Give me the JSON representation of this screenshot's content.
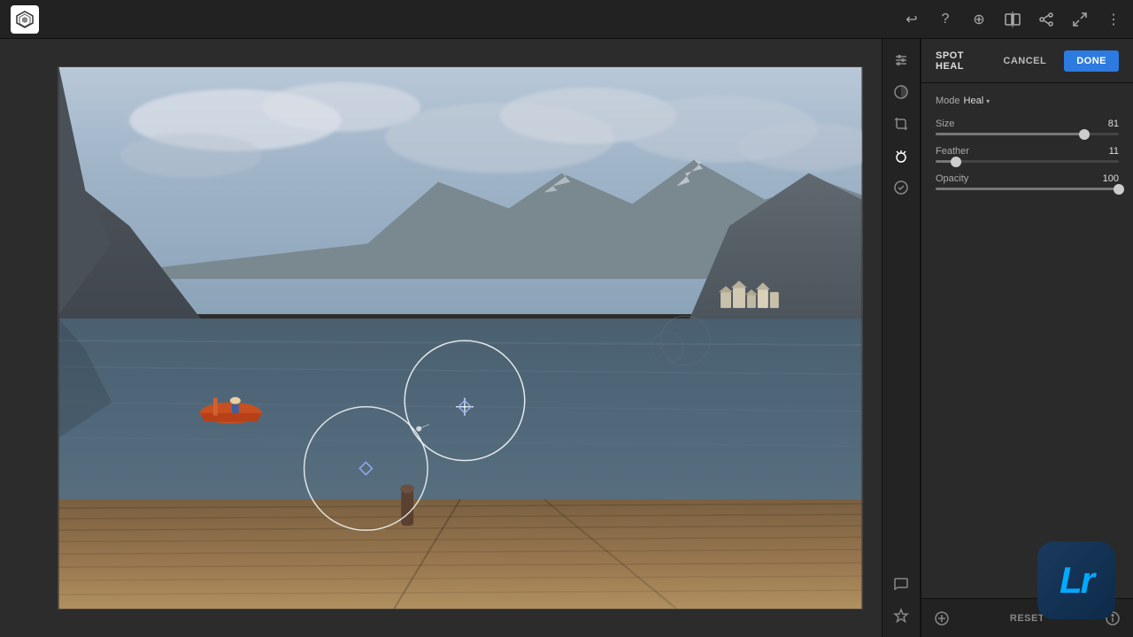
{
  "topbar": {
    "undo_title": "Undo",
    "help_title": "Help",
    "add_title": "Add",
    "compare_title": "Compare",
    "share_title": "Share",
    "expand_title": "Expand",
    "more_title": "More options"
  },
  "spot_heal": {
    "title": "SPOT HEAL",
    "cancel_label": "CANCEL",
    "done_label": "DONE"
  },
  "controls": {
    "mode_label": "Mode",
    "mode_value": "Heal",
    "size_label": "Size",
    "size_value": "81",
    "size_percent": 81,
    "feather_label": "Feather",
    "feather_value": "11",
    "feather_percent": 11,
    "opacity_label": "Opacity",
    "opacity_value": "100",
    "opacity_percent": 100
  },
  "bottom_bar": {
    "reset_label": "RESET"
  },
  "lr_badge": {
    "text": "Lr"
  }
}
